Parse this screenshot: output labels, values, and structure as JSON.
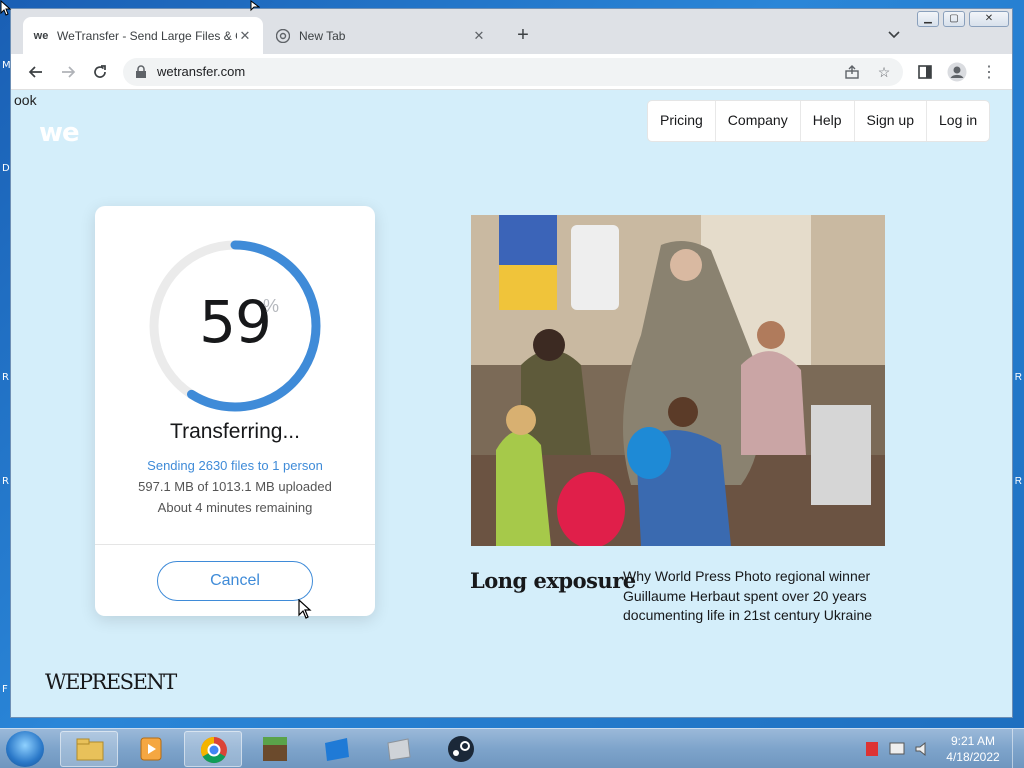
{
  "desktop": {
    "left_fragments": [
      "M",
      "D",
      "R",
      "R",
      "F"
    ],
    "right_fragments": [
      "R",
      "R"
    ]
  },
  "browser": {
    "tabs": [
      {
        "title": "WeTransfer - Send Large Files & G",
        "favicon": "we",
        "active": true
      },
      {
        "title": "New Tab",
        "favicon": "chrome-icon",
        "active": false
      }
    ],
    "url": "wetransfer.com"
  },
  "page": {
    "bleed_text": "ook",
    "logo": "we",
    "nav": [
      "Pricing",
      "Company",
      "Help",
      "Sign up",
      "Log in"
    ],
    "transfer": {
      "percent": "59",
      "percent_sign": "%",
      "progress": 0.59,
      "status": "Transferring...",
      "sending": "Sending 2630 files to 1 person",
      "uploaded": "597.1 MB of 1013.1 MB uploaded",
      "remaining": "About 4 minutes remaining",
      "cancel_label": "Cancel"
    },
    "feature": {
      "title": "Long exposure",
      "text": "Why World Press Photo regional winner Guillaume Herbaut spent over 20 years documenting life in 21st century Ukraine"
    },
    "footer_logo": "WEPRESENT"
  },
  "taskbar": {
    "apps": [
      "folder-icon",
      "media-player-icon",
      "chrome-icon",
      "minecraft-icon",
      "blue-app-icon",
      "grey-app-icon",
      "steam-icon"
    ],
    "time": "9:21 AM",
    "date": "4/18/2022"
  },
  "colors": {
    "page_bg": "#d4eefa",
    "accent": "#3f8bd8",
    "ring_track": "#ebebeb"
  }
}
